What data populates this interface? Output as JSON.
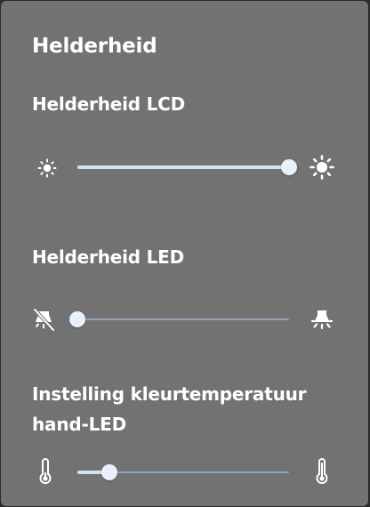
{
  "panel": {
    "title": "Helderheid"
  },
  "sections": [
    {
      "label": "Helderheid LCD",
      "left_icon": "sun-small-icon",
      "right_icon": "sun-large-icon",
      "value_fraction": 1.0
    },
    {
      "label": "Helderheid LED",
      "left_icon": "bulb-off-icon",
      "right_icon": "bulb-on-icon",
      "value_fraction": 0.0
    },
    {
      "label_line1": "Instelling kleurtemperatuur",
      "label_line2": "hand-LED",
      "left_icon": "thermometer-low-icon",
      "right_icon": "thermometer-high-icon",
      "value_fraction": 0.15
    }
  ],
  "colors": {
    "panel_background": "#727272",
    "text": "#ffffff",
    "slider_fill": "#cfe3f4",
    "slider_track": "#8da3b8",
    "slider_thumb": "#e8f1fa"
  }
}
